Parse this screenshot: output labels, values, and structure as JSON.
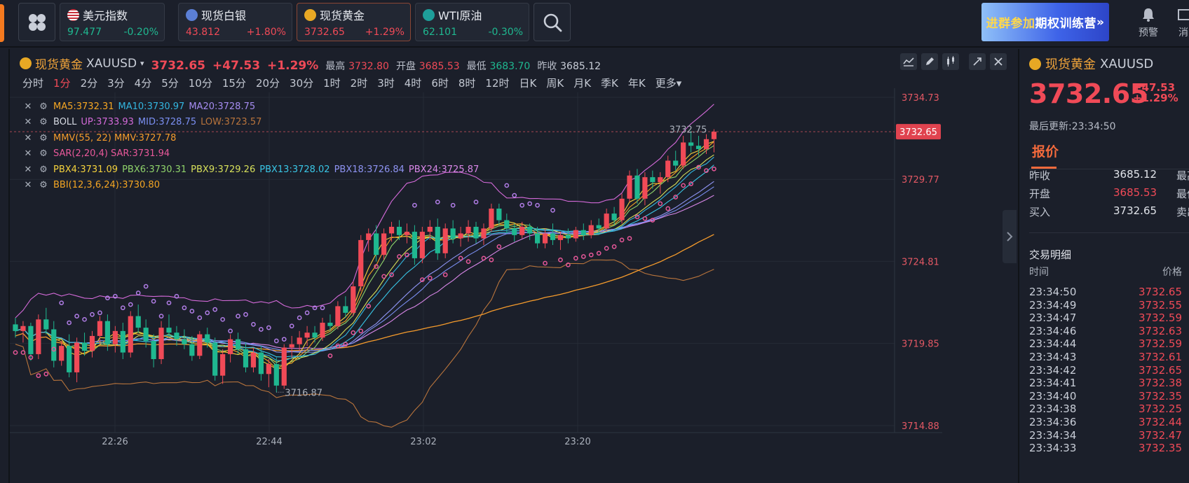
{
  "topbar": {
    "tickers": [
      {
        "name": "美元指数",
        "price": "97.477",
        "change": "-0.20%",
        "dir": "dn",
        "icon": "us-flag-icon"
      },
      {
        "name": "现货白银",
        "price": "43.812",
        "change": "+1.80%",
        "dir": "up",
        "icon": "silver-coin-icon"
      },
      {
        "name": "现货黄金",
        "price": "3732.65",
        "change": "+1.29%",
        "dir": "up",
        "icon": "gold-coin-icon",
        "active": true
      },
      {
        "name": "WTI原油",
        "price": "62.101",
        "change": "-0.30%",
        "dir": "dn",
        "icon": "oil-icon"
      }
    ],
    "promo": {
      "part1": "进群参加",
      "part2": "期权训练营",
      "arrow": "»"
    },
    "alert_label": "预警",
    "msg_label": "消"
  },
  "chart_header": {
    "name": "现货黄金",
    "symbol": "XAUUSD",
    "price": "3732.65",
    "change": "+47.53",
    "change_pct": "+1.29%",
    "high_label": "最高",
    "high": "3732.80",
    "open_label": "开盘",
    "open": "3685.53",
    "low_label": "最低",
    "low": "3683.70",
    "prev_label": "昨收",
    "prev": "3685.12"
  },
  "periods": [
    "分时",
    "1分",
    "2分",
    "3分",
    "4分",
    "5分",
    "10分",
    "15分",
    "20分",
    "30分",
    "1时",
    "2时",
    "3时",
    "4时",
    "6时",
    "8时",
    "12时",
    "日K",
    "周K",
    "月K",
    "季K",
    "年K",
    "更多"
  ],
  "selected_period": "1分",
  "indicators": [
    {
      "parts": [
        {
          "t": "MA5:3732.31",
          "c": "#f5a623"
        },
        {
          "t": "MA10:3730.97",
          "c": "#33b6e0"
        },
        {
          "t": "MA20:3728.75",
          "c": "#a58cf0"
        }
      ]
    },
    {
      "parts": [
        {
          "t": "BOLL",
          "c": "#d6dae2"
        },
        {
          "t": "UP:3733.93",
          "c": "#d46ad9"
        },
        {
          "t": "MID:3728.75",
          "c": "#7b8ff2"
        },
        {
          "t": "LOW:3723.57",
          "c": "#b8743c"
        }
      ]
    },
    {
      "parts": [
        {
          "t": "MMV(55, 22) MMV:3727.78",
          "c": "#f59b2c"
        }
      ]
    },
    {
      "parts": [
        {
          "t": "SAR(2,20,4) SAR:3731.94",
          "c": "#e8589a"
        }
      ]
    },
    {
      "parts": [
        {
          "t": "PBX4:3731.09",
          "c": "#f5d23c"
        },
        {
          "t": "PBX6:3730.31",
          "c": "#8fd36a"
        },
        {
          "t": "PBX9:3729.26",
          "c": "#d7e05a"
        },
        {
          "t": "PBX13:3728.02",
          "c": "#39c6e6"
        },
        {
          "t": "PBX18:3726.84",
          "c": "#8e93f2"
        },
        {
          "t": "PBX24:3725.87",
          "c": "#d987e8"
        }
      ]
    },
    {
      "parts": [
        {
          "t": "BBI(12,3,6,24):3730.80",
          "c": "#f5a623"
        }
      ]
    }
  ],
  "chart_data": {
    "type": "candlestick",
    "y_axis_labels": [
      "3734.73",
      "3729.77",
      "3724.81",
      "3719.85",
      "3714.88"
    ],
    "ylim": [
      3714.88,
      3734.73
    ],
    "x_axis_labels": [
      "22:26",
      "22:44",
      "23:02",
      "23:20"
    ],
    "last_price_tag": "3732.65",
    "annotations": {
      "high": "3732.75",
      "low": "3716.87"
    },
    "candles": [
      [
        3721.0,
        3721.4,
        3720.2,
        3720.6
      ],
      [
        3720.6,
        3721.2,
        3719.9,
        3720.9
      ],
      [
        3720.9,
        3721.1,
        3718.8,
        3719.2
      ],
      [
        3719.2,
        3721.6,
        3718.9,
        3721.3
      ],
      [
        3721.3,
        3722.0,
        3720.4,
        3720.7
      ],
      [
        3720.7,
        3721.2,
        3718.4,
        3718.8
      ],
      [
        3718.8,
        3720.0,
        3718.5,
        3719.7
      ],
      [
        3719.7,
        3720.4,
        3717.8,
        3718.1
      ],
      [
        3718.1,
        3720.2,
        3717.5,
        3719.9
      ],
      [
        3719.9,
        3720.5,
        3719.1,
        3719.4
      ],
      [
        3719.4,
        3720.6,
        3719.0,
        3720.3
      ],
      [
        3720.3,
        3721.5,
        3719.8,
        3721.2
      ],
      [
        3721.2,
        3721.6,
        3719.4,
        3719.8
      ],
      [
        3719.8,
        3720.9,
        3719.3,
        3720.6
      ],
      [
        3720.6,
        3721.1,
        3718.9,
        3719.3
      ],
      [
        3719.3,
        3721.8,
        3719.0,
        3721.5
      ],
      [
        3721.5,
        3722.2,
        3720.5,
        3720.8
      ],
      [
        3720.8,
        3721.3,
        3719.6,
        3720.0
      ],
      [
        3720.0,
        3720.4,
        3718.4,
        3718.9
      ],
      [
        3718.9,
        3721.2,
        3718.6,
        3720.8
      ],
      [
        3720.8,
        3721.6,
        3720.2,
        3720.5
      ],
      [
        3720.5,
        3720.9,
        3719.7,
        3720.1
      ],
      [
        3720.1,
        3720.7,
        3719.5,
        3719.8
      ],
      [
        3719.8,
        3720.3,
        3718.8,
        3719.1
      ],
      [
        3719.1,
        3720.6,
        3718.9,
        3720.4
      ],
      [
        3720.4,
        3720.8,
        3719.6,
        3719.9
      ],
      [
        3719.9,
        3720.2,
        3717.6,
        3717.9
      ],
      [
        3717.9,
        3719.5,
        3717.4,
        3719.2
      ],
      [
        3719.2,
        3720.4,
        3718.7,
        3720.1
      ],
      [
        3720.1,
        3720.5,
        3719.2,
        3719.5
      ],
      [
        3719.5,
        3719.9,
        3718.1,
        3718.4
      ],
      [
        3718.4,
        3719.6,
        3718.1,
        3719.3
      ],
      [
        3719.3,
        3719.7,
        3717.6,
        3718.0
      ],
      [
        3718.0,
        3718.9,
        3717.2,
        3718.6
      ],
      [
        3718.6,
        3719.0,
        3716.9,
        3717.3
      ],
      [
        3717.3,
        3719.8,
        3717.1,
        3719.6
      ],
      [
        3719.6,
        3720.3,
        3719.0,
        3719.8
      ],
      [
        3719.8,
        3720.6,
        3719.4,
        3720.2
      ],
      [
        3720.2,
        3720.9,
        3719.7,
        3720.5
      ],
      [
        3720.5,
        3720.9,
        3719.9,
        3720.2
      ],
      [
        3720.2,
        3721.4,
        3720.0,
        3721.1
      ],
      [
        3721.1,
        3721.6,
        3720.6,
        3720.9
      ],
      [
        3720.9,
        3722.4,
        3720.7,
        3722.1
      ],
      [
        3722.1,
        3722.7,
        3721.4,
        3721.7
      ],
      [
        3721.7,
        3723.6,
        3721.5,
        3723.3
      ],
      [
        3723.3,
        3726.4,
        3723.0,
        3726.1
      ],
      [
        3726.1,
        3726.8,
        3725.4,
        3726.5
      ],
      [
        3726.5,
        3727.0,
        3724.8,
        3725.2
      ],
      [
        3725.2,
        3726.8,
        3724.9,
        3726.5
      ],
      [
        3726.5,
        3727.2,
        3726.0,
        3726.9
      ],
      [
        3726.9,
        3727.3,
        3726.1,
        3726.4
      ],
      [
        3726.4,
        3727.1,
        3725.9,
        3726.6
      ],
      [
        3726.6,
        3727.0,
        3724.6,
        3725.0
      ],
      [
        3725.0,
        3726.9,
        3724.7,
        3726.6
      ],
      [
        3726.6,
        3727.3,
        3726.1,
        3726.9
      ],
      [
        3726.9,
        3727.4,
        3724.9,
        3725.3
      ],
      [
        3725.3,
        3727.1,
        3725.0,
        3726.8
      ],
      [
        3726.8,
        3727.3,
        3725.9,
        3726.2
      ],
      [
        3726.2,
        3726.9,
        3725.7,
        3726.5
      ],
      [
        3726.5,
        3727.3,
        3726.0,
        3726.9
      ],
      [
        3726.9,
        3727.2,
        3725.9,
        3726.2
      ],
      [
        3726.2,
        3727.1,
        3725.8,
        3726.8
      ],
      [
        3726.8,
        3728.3,
        3726.6,
        3728.0
      ],
      [
        3728.0,
        3728.3,
        3727.0,
        3727.3
      ],
      [
        3727.3,
        3727.7,
        3726.5,
        3726.8
      ],
      [
        3726.8,
        3727.1,
        3726.0,
        3726.4
      ],
      [
        3726.4,
        3727.2,
        3726.2,
        3726.9
      ],
      [
        3726.9,
        3727.1,
        3726.1,
        3726.5
      ],
      [
        3726.5,
        3726.9,
        3725.6,
        3725.9
      ],
      [
        3725.9,
        3726.8,
        3725.6,
        3726.5
      ],
      [
        3726.5,
        3727.1,
        3725.8,
        3726.1
      ],
      [
        3726.1,
        3726.6,
        3725.5,
        3726.4
      ],
      [
        3726.4,
        3726.8,
        3725.9,
        3726.2
      ],
      [
        3726.2,
        3726.9,
        3726.0,
        3726.7
      ],
      [
        3726.7,
        3727.1,
        3726.1,
        3726.4
      ],
      [
        3726.4,
        3727.3,
        3726.2,
        3727.0
      ],
      [
        3727.0,
        3727.4,
        3726.5,
        3726.8
      ],
      [
        3726.8,
        3728.0,
        3726.6,
        3727.7
      ],
      [
        3727.7,
        3728.1,
        3727.0,
        3727.3
      ],
      [
        3727.3,
        3728.9,
        3727.1,
        3728.6
      ],
      [
        3728.6,
        3730.3,
        3728.4,
        3730.0
      ],
      [
        3730.0,
        3730.4,
        3728.3,
        3728.6
      ],
      [
        3728.6,
        3730.2,
        3728.2,
        3729.9
      ],
      [
        3729.9,
        3730.3,
        3729.2,
        3729.6
      ],
      [
        3729.6,
        3730.2,
        3728.9,
        3729.9
      ],
      [
        3729.9,
        3731.2,
        3729.6,
        3730.9
      ],
      [
        3730.9,
        3731.5,
        3730.3,
        3730.6
      ],
      [
        3730.6,
        3732.4,
        3730.4,
        3732.0
      ],
      [
        3732.0,
        3732.7,
        3731.4,
        3731.8
      ],
      [
        3731.8,
        3732.4,
        3731.2,
        3731.6
      ],
      [
        3731.6,
        3732.5,
        3731.3,
        3732.2
      ],
      [
        3732.2,
        3732.8,
        3731.4,
        3732.65
      ]
    ]
  },
  "right_panel": {
    "name": "现货黄金",
    "symbol": "XAUUSD",
    "price": "3732.65",
    "change": "+47.53",
    "change_pct": "+1.29%",
    "update_label": "最后更新:23:34:50",
    "tab": "报价",
    "quote_rows": [
      {
        "label": "昨收",
        "value": "3685.12",
        "extra": "最高",
        "color": "#e1e4ea"
      },
      {
        "label": "开盘",
        "value": "3685.53",
        "extra": "最低",
        "color": "#f04a57"
      },
      {
        "label": "买入",
        "value": "3732.65",
        "extra": "卖出",
        "color": "#e1e4ea"
      }
    ],
    "deals_title": "交易明细",
    "deals_time_header": "时间",
    "deals_price_header": "价格",
    "deals": [
      {
        "time": "23:34:50",
        "price": "3732.65"
      },
      {
        "time": "23:34:49",
        "price": "3732.55"
      },
      {
        "time": "23:34:47",
        "price": "3732.59"
      },
      {
        "time": "23:34:46",
        "price": "3732.63"
      },
      {
        "time": "23:34:44",
        "price": "3732.59"
      },
      {
        "time": "23:34:43",
        "price": "3732.61"
      },
      {
        "time": "23:34:42",
        "price": "3732.65"
      },
      {
        "time": "23:34:41",
        "price": "3732.38"
      },
      {
        "time": "23:34:40",
        "price": "3732.35"
      },
      {
        "time": "23:34:38",
        "price": "3732.25"
      },
      {
        "time": "23:34:36",
        "price": "3732.44"
      },
      {
        "time": "23:34:34",
        "price": "3732.47"
      },
      {
        "time": "23:34:33",
        "price": "3732.35"
      }
    ]
  },
  "colors": {
    "up": "#f04a57",
    "down": "#1fb890",
    "accent": "#f0a43a",
    "bg": "#1b1f2a"
  }
}
